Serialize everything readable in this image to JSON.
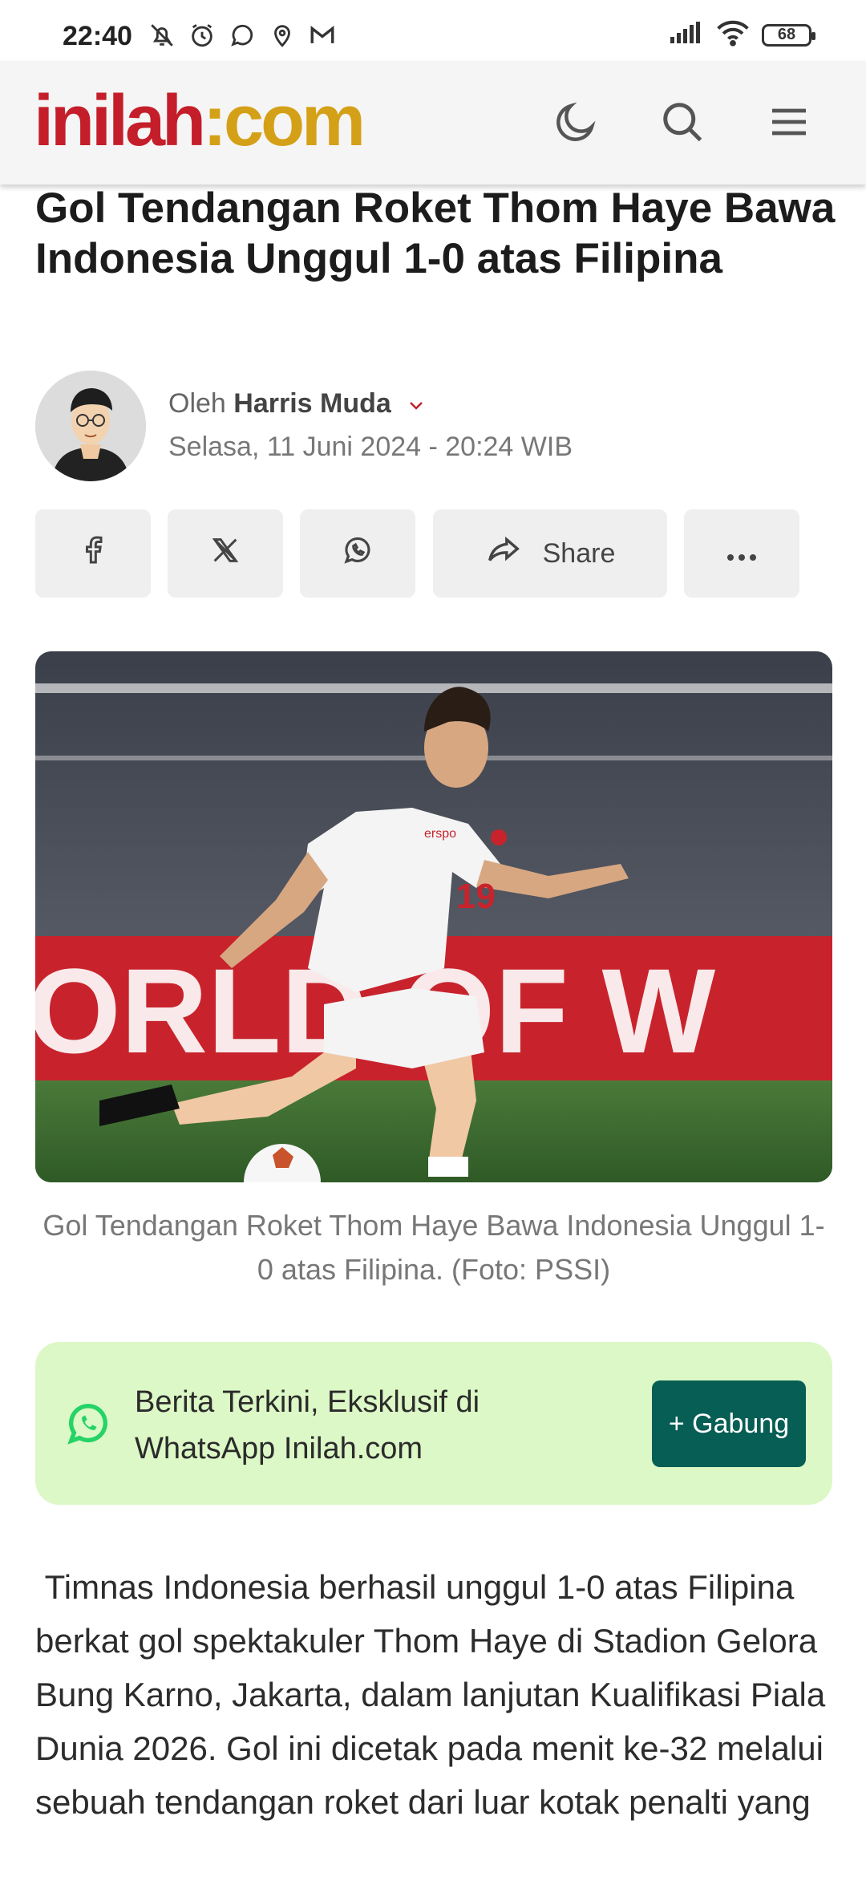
{
  "status_bar": {
    "time": "22:40",
    "icons": [
      "bell-off-icon",
      "alarm-icon",
      "whatsapp-icon",
      "location-icon",
      "gmail-icon"
    ],
    "signal_icon": "signal-icon",
    "wifi_icon": "wifi-icon",
    "battery": "68"
  },
  "header": {
    "logo_part1": "inilah",
    "logo_part2": "com",
    "logo_colors": {
      "part1": "#c41e2a",
      "part2": "#d4a017"
    },
    "icons": [
      "moon-icon",
      "search-icon",
      "menu-icon"
    ]
  },
  "article": {
    "title": "Gol Tendangan Roket Thom Haye Bawa Indonesia Unggul 1-0 atas Filipina",
    "byline_prefix": "Oleh",
    "author": "Harris Muda",
    "date": "Selasa, 11 Juni 2024 - 20:24 WIB",
    "share": {
      "share_label": "Share",
      "icons": [
        "facebook-icon",
        "x-icon",
        "whatsapp-icon",
        "share-icon",
        "more-icon"
      ]
    },
    "image_caption": "Gol Tendangan Roket Thom Haye Bawa Indonesia Unggul 1-0 atas Filipina. (Foto: PSSI)",
    "body": " Timnas Indonesia berhasil unggul 1-0 atas Filipina berkat gol spektakuler Thom Haye di Stadion Gelora Bung Karno, Jakarta, dalam lanjutan Kualifikasi Piala Dunia 2026. Gol ini dicetak pada menit ke-32 melalui sebuah tendangan roket dari luar kotak penalti yang"
  },
  "whatsapp_banner": {
    "text": "Berita Terkini, Eksklusif di WhatsApp Inilah.com",
    "button": "+ Gabung",
    "colors": {
      "background": "#dcf8c6",
      "button": "#075e54",
      "icon": "#25d366"
    }
  },
  "photo": {
    "banner_text": "ORLD OF W",
    "sponsor": "erspo",
    "jersey_number": "19"
  }
}
